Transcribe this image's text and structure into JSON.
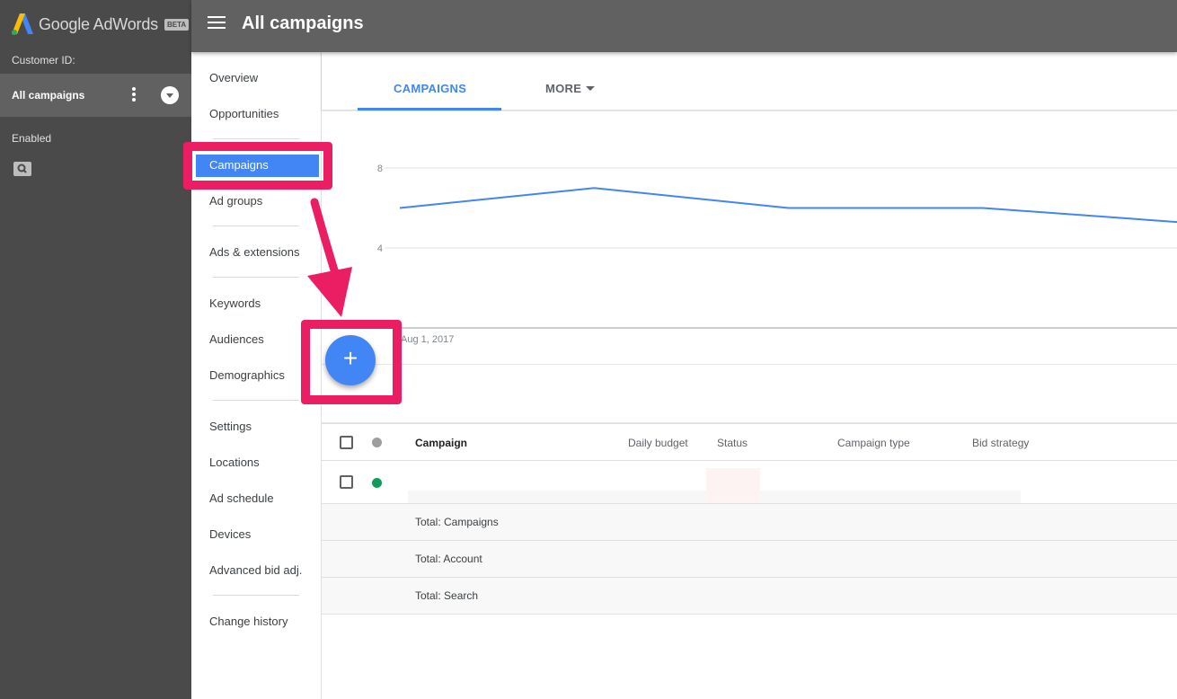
{
  "app": {
    "brand": "Google AdWords",
    "beta": "BETA"
  },
  "left_panel": {
    "customer_id_label": "Customer ID:",
    "selected_account": "All campaigns",
    "filter_status": "Enabled"
  },
  "header": {
    "title": "All campaigns"
  },
  "nav": {
    "items": [
      "Overview",
      "Opportunities",
      "Campaigns",
      "Ad groups",
      "Ads & extensions",
      "Keywords",
      "Audiences",
      "Demographics",
      "Settings",
      "Locations",
      "Ad schedule",
      "Devices",
      "Advanced bid adj.",
      "Change history"
    ],
    "active": "Campaigns"
  },
  "tabs": {
    "campaigns": "CAMPAIGNS",
    "more": "MORE"
  },
  "chart_data": {
    "type": "line",
    "x": [
      "",
      "",
      "",
      "",
      ""
    ],
    "series": [
      {
        "values": [
          6.0,
          7.0,
          6.0,
          6.0,
          5.3
        ]
      }
    ],
    "y_ticks": [
      "8",
      "4"
    ],
    "ylim": [
      0,
      8
    ],
    "x_tick_label": "Aug 1, 2017",
    "color": "#4285f4",
    "grid": true
  },
  "fab": {
    "label": "+"
  },
  "table": {
    "columns": [
      "Campaign",
      "Daily budget",
      "Status",
      "Campaign type",
      "Bid strategy"
    ],
    "totals": [
      "Total: Campaigns",
      "Total: Account",
      "Total: Search"
    ]
  },
  "colors": {
    "accent": "#4285f4",
    "highlight": "#ec1e63",
    "enabled_dot": "#0f9d58",
    "header_dot": "#9e9e9e"
  }
}
